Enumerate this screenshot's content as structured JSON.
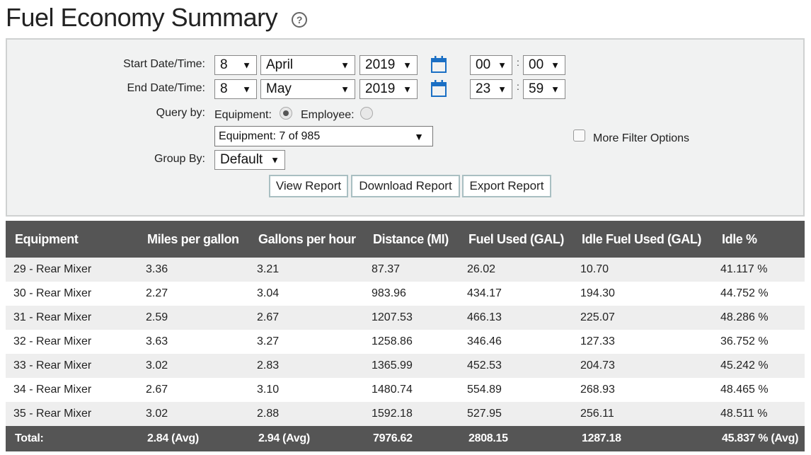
{
  "page": {
    "title": "Fuel Economy Summary",
    "help": "?"
  },
  "filters": {
    "start_label": "Start Date/Time:",
    "start": {
      "day": "8",
      "month": "April",
      "year": "2019",
      "hour": "00",
      "minute": "00"
    },
    "end_label": "End Date/Time:",
    "end": {
      "day": "8",
      "month": "May",
      "year": "2019",
      "hour": "23",
      "minute": "59"
    },
    "time_separator": ":",
    "query_by_label": "Query by:",
    "query_options": [
      {
        "label": "Equipment:",
        "selected": true
      },
      {
        "label": "Employee:",
        "selected": false
      }
    ],
    "equipment_select": "Equipment: 7 of 985",
    "more_filter_label": "More Filter Options",
    "more_filter_checked": false,
    "group_by_label": "Group By:",
    "group_by_value": "Default",
    "buttons": {
      "view": "View Report",
      "download": "Download Report",
      "export": "Export Report"
    }
  },
  "table": {
    "columns": [
      "Equipment",
      "Miles per gallon",
      "Gallons per hour",
      "Distance (MI)",
      "Fuel Used (GAL)",
      "Idle Fuel Used (GAL)",
      "Idle %"
    ],
    "rows": [
      [
        "29 - Rear Mixer",
        "3.36",
        "3.21",
        "87.37",
        "26.02",
        "10.70",
        "41.117 %"
      ],
      [
        "30 - Rear Mixer",
        "2.27",
        "3.04",
        "983.96",
        "434.17",
        "194.30",
        "44.752 %"
      ],
      [
        "31 - Rear Mixer",
        "2.59",
        "2.67",
        "1207.53",
        "466.13",
        "225.07",
        "48.286 %"
      ],
      [
        "32 - Rear Mixer",
        "3.63",
        "3.27",
        "1258.86",
        "346.46",
        "127.33",
        "36.752 %"
      ],
      [
        "33 - Rear Mixer",
        "3.02",
        "2.83",
        "1365.99",
        "452.53",
        "204.73",
        "45.242 %"
      ],
      [
        "34 - Rear Mixer",
        "2.67",
        "3.10",
        "1480.74",
        "554.89",
        "268.93",
        "48.465 %"
      ],
      [
        "35 - Rear Mixer",
        "3.02",
        "2.88",
        "1592.18",
        "527.95",
        "256.11",
        "48.511 %"
      ]
    ],
    "total": [
      "Total:",
      "2.84 (Avg)",
      "2.94 (Avg)",
      "7976.62",
      "2808.15",
      "1287.18",
      "45.837 % (Avg)"
    ]
  },
  "colors": {
    "header_bg": "#555555",
    "panel_bg": "#f1f2f2",
    "calendar_blue": "#1a6fc4",
    "button_border": "#a9bfc2"
  }
}
